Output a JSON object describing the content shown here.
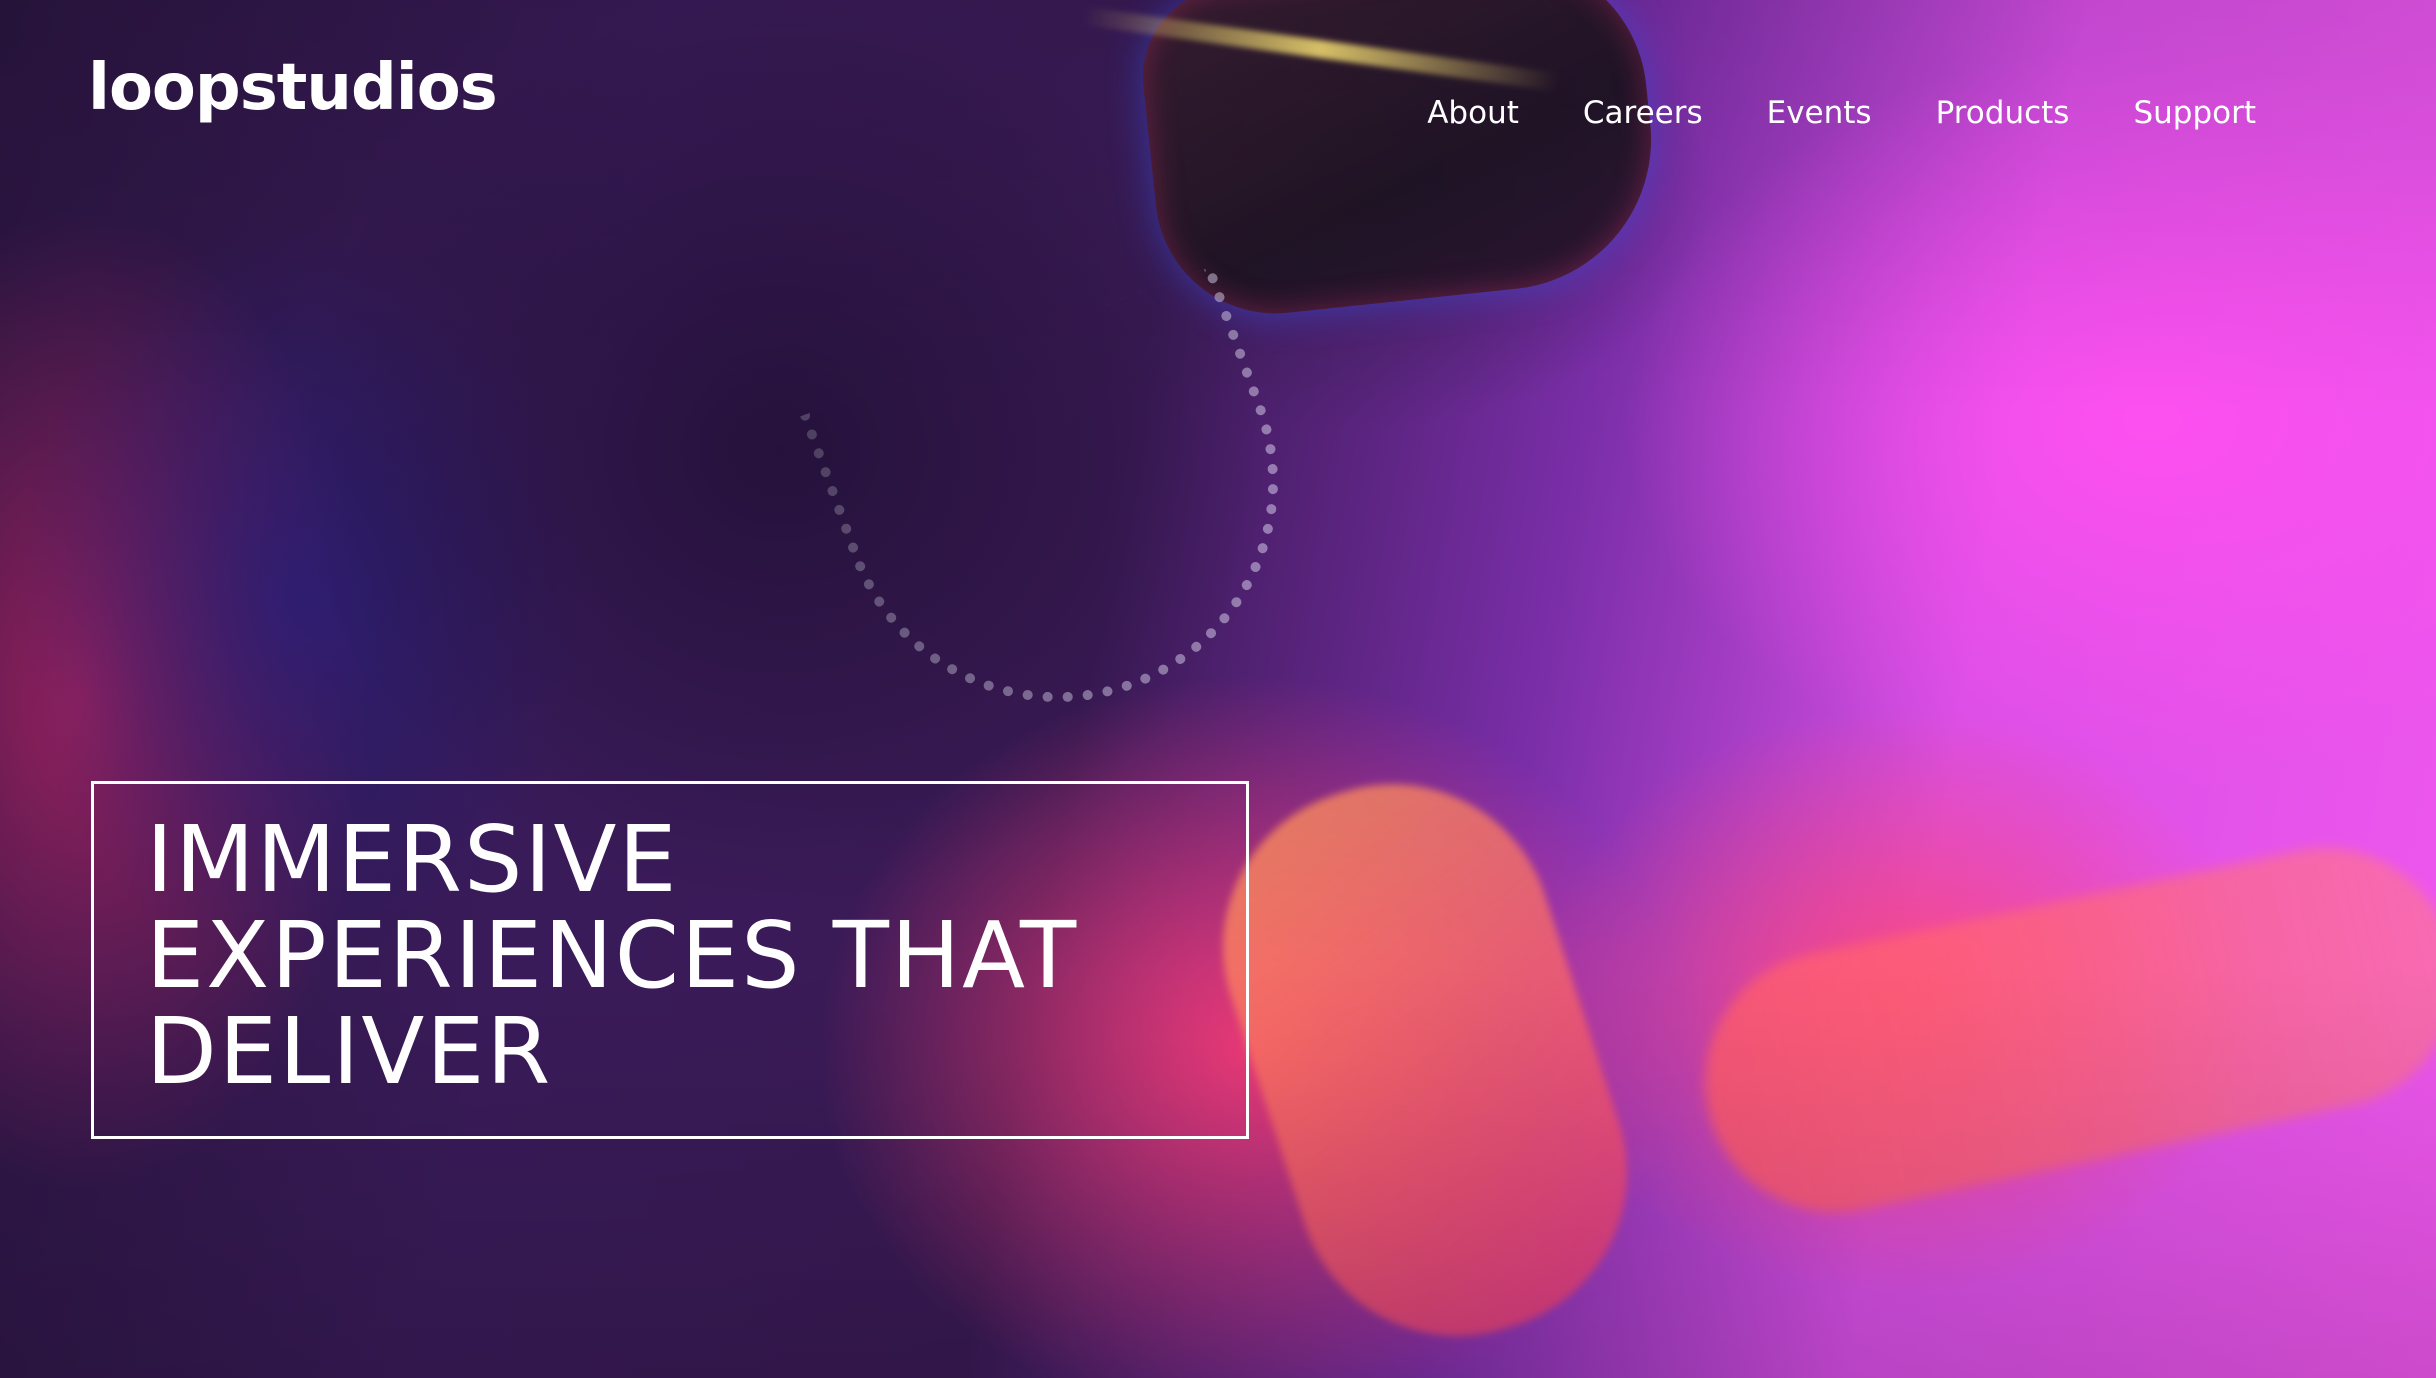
{
  "header": {
    "logo": "loopstudios",
    "nav": [
      {
        "label": "About"
      },
      {
        "label": "Careers"
      },
      {
        "label": "Events"
      },
      {
        "label": "Products"
      },
      {
        "label": "Support"
      }
    ]
  },
  "hero": {
    "headline_lines": [
      "IMMERSIVE",
      "EXPERIENCES THAT",
      "DELIVER"
    ],
    "image": "vr-headset-neon-photo"
  },
  "colors": {
    "text": "#ffffff",
    "accent_magenta": "#f057ee",
    "accent_pink": "#ff4a7a",
    "deep_purple": "#2a1540"
  }
}
